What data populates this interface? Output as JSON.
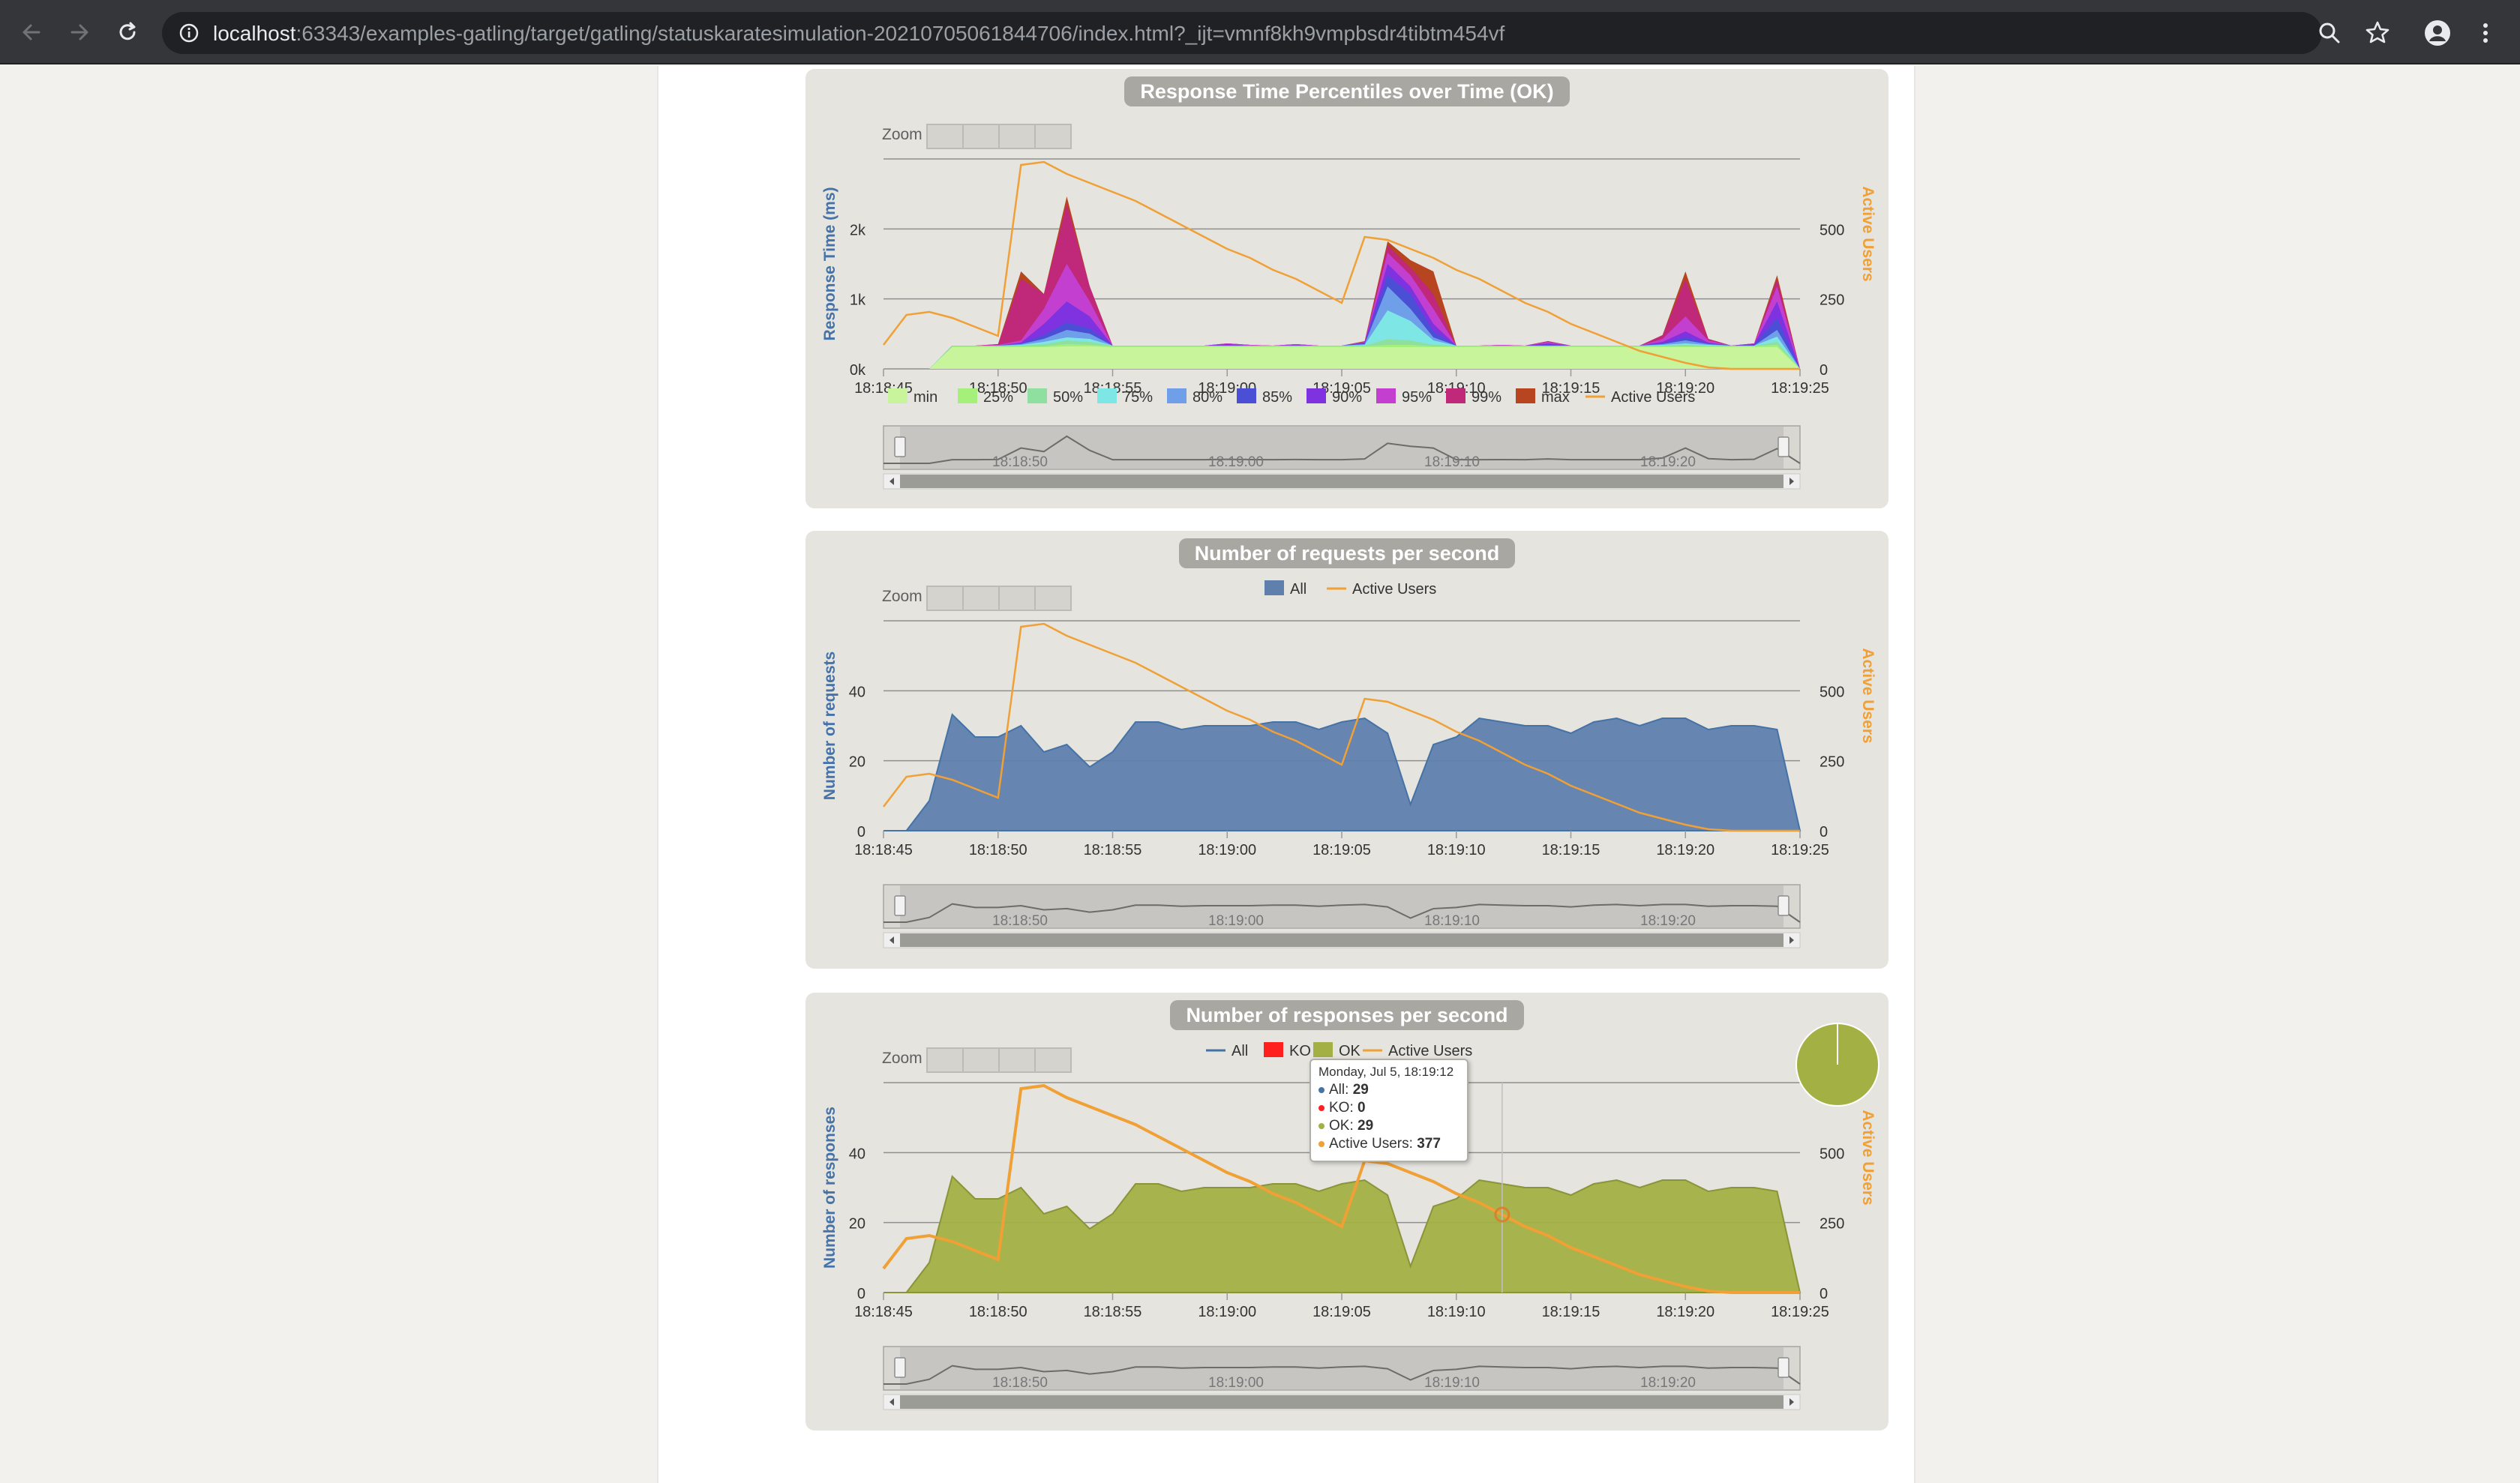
{
  "browser": {
    "url_host": "localhost",
    "url_rest": ":63343/examples-gatling/target/gatling/statuskaratesimulation-20210705061844706/index.html?_ijt=vmnf8kh9vmpbsdr4tibtm454vf",
    "icons": [
      "back-arrow-icon",
      "forward-arrow-icon",
      "reload-icon",
      "info-icon",
      "zoom-icon",
      "star-icon",
      "profile-icon",
      "kebab-menu-icon"
    ],
    "colors": {
      "toolbar": "#35363a",
      "omnibox": "#202124"
    }
  },
  "zoom_label": "Zoom",
  "time_ticks": [
    "18:18:45",
    "18:18:50",
    "18:18:55",
    "18:19:00",
    "18:19:05",
    "18:19:10",
    "18:19:15",
    "18:19:20",
    "18:19:25"
  ],
  "navigator_ticks": [
    "18:18:50",
    "18:19:00",
    "18:19:10",
    "18:19:20"
  ],
  "right_axis_label": "Active Users",
  "right_axis_ticks": [
    "0",
    "250",
    "500"
  ],
  "colors": {
    "panel_bg": "#e5e4df",
    "grid": "#8f8f8f",
    "active_users": "#f0a035",
    "requests_area": "#5f7fad",
    "responses_area": "#a3b043",
    "left_axis_label": "#4572a7",
    "ko": "#ff1f1f"
  },
  "chart_data": [
    {
      "type": "area",
      "title": "Response Time Percentiles over Time (OK)",
      "ylabel": "Response Time (ms)",
      "y_ticks": [
        "0k",
        "1k",
        "2k"
      ],
      "ylim": [
        0,
        2800
      ],
      "y2label": "Active Users",
      "y2lim": [
        0,
        700
      ],
      "x": [
        "18:18:45",
        "18:18:46",
        "18:18:47",
        "18:18:48",
        "18:18:49",
        "18:18:50",
        "18:18:51",
        "18:18:52",
        "18:18:53",
        "18:18:54",
        "18:18:55",
        "18:18:56",
        "18:18:57",
        "18:18:58",
        "18:18:59",
        "18:19:00",
        "18:19:01",
        "18:19:02",
        "18:19:03",
        "18:19:04",
        "18:19:05",
        "18:19:06",
        "18:19:07",
        "18:19:08",
        "18:19:09",
        "18:19:10",
        "18:19:11",
        "18:19:12",
        "18:19:13",
        "18:19:14",
        "18:19:15",
        "18:19:16",
        "18:19:17",
        "18:19:18",
        "18:19:19",
        "18:19:20",
        "18:19:21",
        "18:19:22",
        "18:19:23",
        "18:19:24",
        "18:19:25"
      ],
      "legend": [
        "min",
        "25%",
        "50%",
        "75%",
        "80%",
        "85%",
        "90%",
        "95%",
        "99%",
        "max",
        "Active Users"
      ],
      "series": [
        {
          "name": "min",
          "color": "#c8f59c",
          "values": [
            0,
            0,
            0,
            290,
            290,
            290,
            290,
            290,
            300,
            300,
            290,
            290,
            290,
            290,
            290,
            290,
            290,
            290,
            290,
            290,
            290,
            290,
            290,
            290,
            290,
            290,
            290,
            290,
            290,
            290,
            290,
            290,
            290,
            290,
            290,
            290,
            290,
            290,
            290,
            290,
            0
          ]
        },
        {
          "name": "25%",
          "color": "#a5f07a",
          "values": [
            0,
            0,
            0,
            300,
            300,
            300,
            300,
            300,
            330,
            320,
            300,
            300,
            300,
            300,
            300,
            300,
            300,
            300,
            300,
            300,
            300,
            300,
            320,
            320,
            300,
            300,
            300,
            300,
            300,
            300,
            300,
            300,
            300,
            300,
            300,
            300,
            300,
            300,
            300,
            320,
            0
          ]
        },
        {
          "name": "50%",
          "color": "#8fe0a0",
          "values": [
            0,
            0,
            0,
            310,
            310,
            310,
            310,
            330,
            380,
            360,
            310,
            310,
            310,
            310,
            310,
            310,
            310,
            310,
            310,
            310,
            310,
            310,
            400,
            380,
            320,
            310,
            310,
            310,
            310,
            310,
            310,
            310,
            310,
            310,
            310,
            320,
            310,
            310,
            310,
            360,
            0
          ]
        },
        {
          "name": "75%",
          "color": "#7fe6e6",
          "values": [
            0,
            0,
            0,
            310,
            310,
            310,
            320,
            360,
            420,
            400,
            310,
            310,
            310,
            310,
            310,
            310,
            310,
            310,
            310,
            310,
            310,
            320,
            780,
            640,
            380,
            310,
            310,
            310,
            310,
            310,
            310,
            310,
            310,
            310,
            320,
            340,
            320,
            310,
            310,
            430,
            0
          ]
        },
        {
          "name": "80%",
          "color": "#6e9fe8",
          "values": [
            0,
            0,
            0,
            310,
            310,
            310,
            330,
            400,
            520,
            470,
            310,
            310,
            310,
            310,
            310,
            310,
            310,
            310,
            310,
            310,
            310,
            330,
            1100,
            800,
            420,
            310,
            310,
            310,
            310,
            310,
            310,
            310,
            310,
            310,
            330,
            380,
            330,
            310,
            310,
            520,
            0
          ]
        },
        {
          "name": "85%",
          "color": "#4a4fd6",
          "values": [
            0,
            0,
            0,
            310,
            310,
            310,
            340,
            450,
            620,
            540,
            310,
            310,
            310,
            310,
            310,
            310,
            310,
            310,
            310,
            310,
            310,
            340,
            1250,
            1000,
            500,
            310,
            310,
            310,
            310,
            320,
            310,
            310,
            310,
            310,
            340,
            420,
            340,
            310,
            320,
            680,
            0
          ]
        },
        {
          "name": "90%",
          "color": "#7f33e0",
          "values": [
            0,
            0,
            0,
            310,
            310,
            310,
            350,
            600,
            900,
            700,
            310,
            310,
            310,
            310,
            310,
            330,
            310,
            310,
            320,
            310,
            310,
            350,
            1400,
            1100,
            600,
            310,
            310,
            310,
            310,
            340,
            310,
            310,
            310,
            310,
            360,
            500,
            350,
            310,
            330,
            900,
            0
          ]
        },
        {
          "name": "95%",
          "color": "#c33fd0",
          "values": [
            0,
            0,
            0,
            310,
            310,
            320,
            380,
            800,
            1400,
            900,
            310,
            310,
            310,
            310,
            310,
            340,
            320,
            310,
            330,
            310,
            310,
            360,
            1550,
            1250,
            800,
            310,
            310,
            320,
            310,
            360,
            310,
            310,
            310,
            310,
            400,
            700,
            380,
            310,
            340,
            1100,
            0
          ]
        },
        {
          "name": "99%",
          "color": "#c0287a",
          "values": [
            0,
            0,
            0,
            310,
            310,
            330,
            1200,
            1000,
            2200,
            1100,
            310,
            310,
            310,
            310,
            310,
            340,
            320,
            310,
            330,
            310,
            310,
            360,
            1650,
            1350,
            1000,
            310,
            310,
            320,
            310,
            370,
            310,
            310,
            310,
            310,
            450,
            1200,
            400,
            310,
            340,
            1200,
            0
          ]
        },
        {
          "name": "max",
          "color": "#b7451f",
          "values": [
            0,
            0,
            0,
            310,
            310,
            330,
            1300,
            1000,
            2300,
            1100,
            310,
            310,
            310,
            310,
            310,
            340,
            320,
            310,
            330,
            310,
            310,
            370,
            1700,
            1450,
            1300,
            310,
            310,
            320,
            310,
            370,
            310,
            310,
            310,
            310,
            450,
            1300,
            400,
            310,
            340,
            1250,
            0
          ]
        }
      ],
      "active_users": [
        80,
        180,
        190,
        170,
        140,
        110,
        680,
        690,
        650,
        620,
        590,
        560,
        520,
        480,
        440,
        400,
        370,
        330,
        300,
        260,
        220,
        440,
        430,
        400,
        370,
        330,
        300,
        260,
        220,
        190,
        150,
        120,
        90,
        60,
        40,
        20,
        5,
        0,
        0,
        0,
        0
      ]
    },
    {
      "type": "area",
      "title": "Number of requests per second",
      "ylabel": "Number of requests",
      "y_ticks": [
        "0",
        "20",
        "40"
      ],
      "ylim": [
        0,
        56
      ],
      "y2label": "Active Users",
      "y2lim": [
        0,
        700
      ],
      "x": [
        "18:18:45",
        "18:18:46",
        "18:18:47",
        "18:18:48",
        "18:18:49",
        "18:18:50",
        "18:18:51",
        "18:18:52",
        "18:18:53",
        "18:18:54",
        "18:18:55",
        "18:18:56",
        "18:18:57",
        "18:18:58",
        "18:18:59",
        "18:19:00",
        "18:19:01",
        "18:19:02",
        "18:19:03",
        "18:19:04",
        "18:19:05",
        "18:19:06",
        "18:19:07",
        "18:19:08",
        "18:19:09",
        "18:19:10",
        "18:19:11",
        "18:19:12",
        "18:19:13",
        "18:19:14",
        "18:19:15",
        "18:19:16",
        "18:19:17",
        "18:19:18",
        "18:19:19",
        "18:19:20",
        "18:19:21",
        "18:19:22",
        "18:19:23",
        "18:19:24",
        "18:19:25"
      ],
      "legend": [
        "All",
        "Active Users"
      ],
      "series": [
        {
          "name": "All",
          "color": "#5f7fad",
          "values": [
            0,
            0,
            8,
            31,
            25,
            25,
            28,
            21,
            23,
            17,
            21,
            29,
            29,
            27,
            28,
            28,
            28,
            29,
            29,
            27,
            29,
            30,
            26,
            7,
            23,
            25,
            30,
            29,
            28,
            28,
            26,
            29,
            30,
            28,
            30,
            30,
            27,
            28,
            28,
            27,
            0
          ]
        }
      ],
      "active_users": [
        80,
        180,
        190,
        170,
        140,
        110,
        680,
        690,
        650,
        620,
        590,
        560,
        520,
        480,
        440,
        400,
        370,
        330,
        300,
        260,
        220,
        440,
        430,
        400,
        370,
        330,
        300,
        260,
        220,
        190,
        150,
        120,
        90,
        60,
        40,
        20,
        5,
        0,
        0,
        0,
        0
      ]
    },
    {
      "type": "area",
      "title": "Number of responses per second",
      "ylabel": "Number of responses",
      "y_ticks": [
        "0",
        "20",
        "40"
      ],
      "ylim": [
        0,
        56
      ],
      "y2label": "Active Users",
      "y2lim": [
        0,
        700
      ],
      "x": [
        "18:18:45",
        "18:18:46",
        "18:18:47",
        "18:18:48",
        "18:18:49",
        "18:18:50",
        "18:18:51",
        "18:18:52",
        "18:18:53",
        "18:18:54",
        "18:18:55",
        "18:18:56",
        "18:18:57",
        "18:18:58",
        "18:18:59",
        "18:19:00",
        "18:19:01",
        "18:19:02",
        "18:19:03",
        "18:19:04",
        "18:19:05",
        "18:19:06",
        "18:19:07",
        "18:19:08",
        "18:19:09",
        "18:19:10",
        "18:19:11",
        "18:19:12",
        "18:19:13",
        "18:19:14",
        "18:19:15",
        "18:19:16",
        "18:19:17",
        "18:19:18",
        "18:19:19",
        "18:19:20",
        "18:19:21",
        "18:19:22",
        "18:19:23",
        "18:19:24",
        "18:19:25"
      ],
      "legend": [
        "All",
        "KO",
        "OK",
        "Active Users"
      ],
      "series": [
        {
          "name": "OK",
          "color": "#a3b043",
          "values": [
            0,
            0,
            8,
            31,
            25,
            25,
            28,
            21,
            23,
            17,
            21,
            29,
            29,
            27,
            28,
            28,
            28,
            29,
            29,
            27,
            29,
            30,
            26,
            7,
            23,
            25,
            30,
            29,
            28,
            28,
            26,
            29,
            30,
            28,
            30,
            30,
            27,
            28,
            28,
            27,
            0
          ]
        },
        {
          "name": "KO",
          "color": "#ff1f1f",
          "values": [
            0,
            0,
            0,
            0,
            0,
            0,
            0,
            0,
            0,
            0,
            0,
            0,
            0,
            0,
            0,
            0,
            0,
            0,
            0,
            0,
            0,
            0,
            0,
            0,
            0,
            0,
            0,
            0,
            0,
            0,
            0,
            0,
            0,
            0,
            0,
            0,
            0,
            0,
            0,
            0,
            0
          ]
        }
      ],
      "active_users": [
        80,
        180,
        190,
        170,
        140,
        110,
        680,
        690,
        650,
        620,
        590,
        560,
        520,
        480,
        440,
        400,
        370,
        330,
        300,
        260,
        220,
        440,
        430,
        400,
        370,
        330,
        300,
        260,
        220,
        190,
        150,
        120,
        90,
        60,
        40,
        20,
        5,
        0,
        0,
        0,
        0
      ],
      "pie": [
        {
          "name": "OK",
          "value": 100,
          "color": "#a3b043"
        },
        {
          "name": "KO",
          "value": 0,
          "color": "#ff1f1f"
        }
      ],
      "tooltip": {
        "header": "Monday, Jul 5, 18:19:12",
        "rows": [
          {
            "label": "All:",
            "value": "29",
            "color": "#4572a7"
          },
          {
            "label": "KO:",
            "value": "0",
            "color": "#ff1f1f"
          },
          {
            "label": "OK:",
            "value": "29",
            "color": "#a3b043"
          },
          {
            "label": "Active Users:",
            "value": "377",
            "color": "#f0a035"
          }
        ]
      }
    }
  ]
}
